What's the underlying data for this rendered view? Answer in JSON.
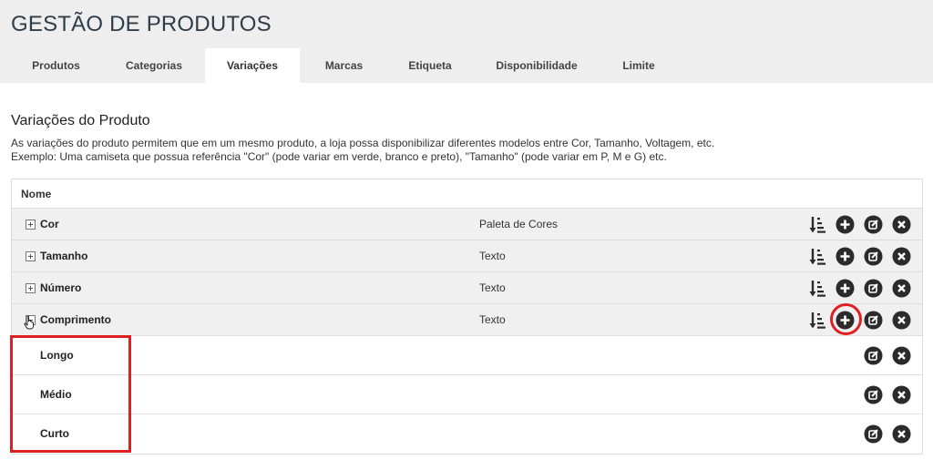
{
  "header": {
    "title": "GESTÃO DE PRODUTOS"
  },
  "tabs": [
    {
      "label": "Produtos",
      "active": false
    },
    {
      "label": "Categorias",
      "active": false
    },
    {
      "label": "Variações",
      "active": true
    },
    {
      "label": "Marcas",
      "active": false
    },
    {
      "label": "Etiqueta",
      "active": false
    },
    {
      "label": "Disponibilidade",
      "active": false
    },
    {
      "label": "Limite",
      "active": false
    }
  ],
  "section": {
    "title": "Variações do Produto",
    "desc_line1": "As variações do produto permitem que em um mesmo produto, a loja possa disponibilizar diferentes modelos entre Cor, Tamanho, Voltagem, etc.",
    "desc_line2": "Exemplo: Uma camiseta que possua referência \"Cor\" (pode variar em verde, branco e preto), \"Tamanho\" (pode variar em P, M e G) etc."
  },
  "table": {
    "header": "Nome",
    "rows": [
      {
        "name": "Cor",
        "type": "Paleta de Cores",
        "expanded": false
      },
      {
        "name": "Tamanho",
        "type": "Texto",
        "expanded": false
      },
      {
        "name": "Número",
        "type": "Texto",
        "expanded": false
      },
      {
        "name": "Comprimento",
        "type": "Texto",
        "expanded": true
      }
    ],
    "subrows": [
      {
        "name": "Longo"
      },
      {
        "name": "Médio"
      },
      {
        "name": "Curto"
      }
    ]
  },
  "icons": {
    "sort": "sort-icon",
    "add": "add-circle-icon",
    "edit": "edit-icon",
    "delete": "delete-icon"
  },
  "colors": {
    "accent": "#2f3d4a",
    "icon": "#2b2b2b",
    "highlight": "#e02020",
    "header_bg": "#eeeeee",
    "row_bg": "#f0f0f0"
  }
}
